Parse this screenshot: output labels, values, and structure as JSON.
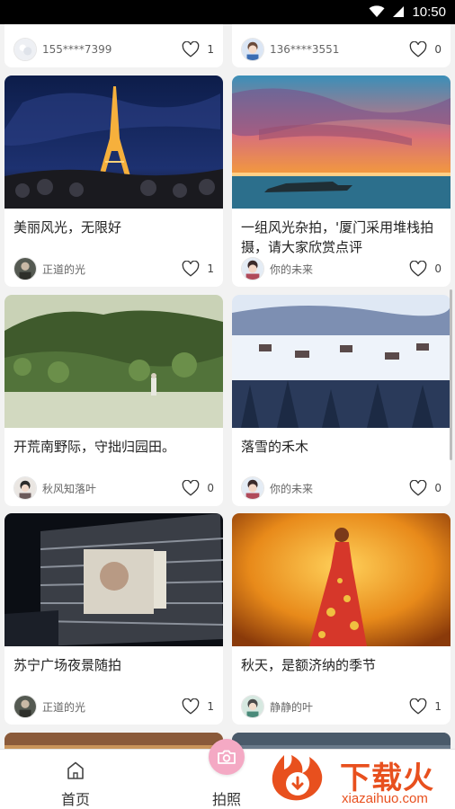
{
  "status_bar": {
    "time": "10:50",
    "icons": [
      "wifi-icon",
      "cellular-signal-icon"
    ]
  },
  "feed": {
    "partial_top": [
      {
        "author": "155****7399",
        "likes": "1"
      },
      {
        "author": "136****3551",
        "likes": "0"
      }
    ],
    "cards": [
      {
        "title": "美丽风光，无限好",
        "author": "正道的光",
        "likes": "1"
      },
      {
        "title": "一组风光杂拍，'厦门采用堆栈拍摄，请大家欣赏点评",
        "author": "你的未来",
        "likes": "0"
      },
      {
        "title": "开荒南野际，守拙归园田。",
        "author": "秋风知落叶",
        "likes": "0"
      },
      {
        "title": "落雪的禾木",
        "author": "你的未来",
        "likes": "0"
      },
      {
        "title": "苏宁广场夜景随拍",
        "author": "正道的光",
        "likes": "1"
      },
      {
        "title": "秋天，是额济纳的季节",
        "author": "静静的叶",
        "likes": "1"
      }
    ]
  },
  "bottom_nav": {
    "items": [
      {
        "label": "首页",
        "icon": "home-icon"
      },
      {
        "label": "拍照",
        "icon": "camera-icon"
      }
    ]
  },
  "watermark": {
    "title": "下载火",
    "domain": "xiazaihuo.com"
  },
  "colors": {
    "camera_fab": "#f4a9c4",
    "watermark": "#e8501e"
  }
}
